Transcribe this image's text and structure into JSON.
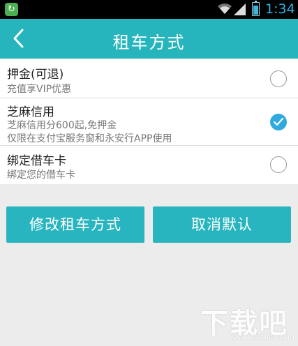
{
  "status_bar": {
    "time": "1:34"
  },
  "app_bar": {
    "title": "租车方式"
  },
  "options": [
    {
      "title": "押金(可退)",
      "desc": "充值享VIP优惠",
      "checked": false
    },
    {
      "title": "芝麻信用",
      "desc": "芝麻信用分600起,免押金",
      "desc2": "仅限在支付宝服务窗和永安行APP使用",
      "checked": true
    },
    {
      "title": "绑定借车卡",
      "desc": "绑定您的借车卡",
      "checked": false
    }
  ],
  "buttons": {
    "change_label": "修改租车方式",
    "cancel_default_label": "取消默认"
  },
  "watermark": {
    "logo": "下载吧",
    "url": "www.xiazaiba.com"
  },
  "colors": {
    "app_bar": "#26b5bd",
    "button": "#28b5bf",
    "checked_radio": "#2fa9e0",
    "background": "#ececec"
  }
}
